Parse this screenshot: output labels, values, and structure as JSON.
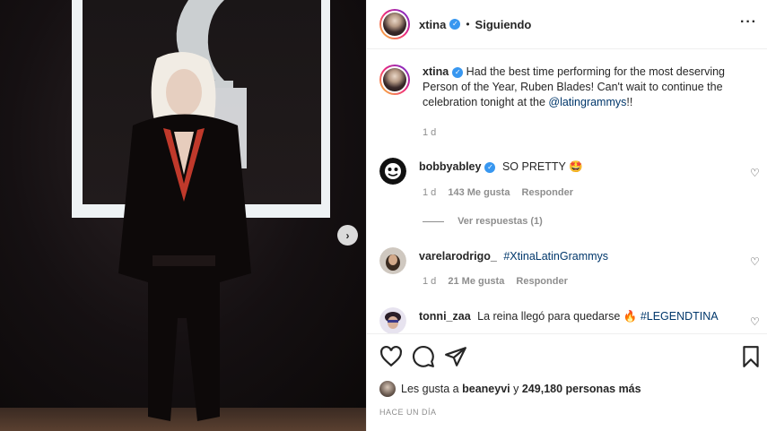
{
  "header": {
    "username": "xtina",
    "separator": "•",
    "follow_status": "Siguiendo",
    "more_icon": "more-horizontal-icon"
  },
  "caption": {
    "username": "xtina",
    "text": "Had the best time performing for the most deserving Person of the Year, Ruben Blades! Can't wait to continue the celebration tonight at the ",
    "mention": "@latingrammys",
    "suffix": "!!",
    "time": "1 d"
  },
  "comments": [
    {
      "username": "bobbyabley",
      "verified": true,
      "text": "SO PRETTY 🤩",
      "time": "1 d",
      "likes": "143 Me gusta",
      "reply": "Responder",
      "view_replies": "Ver respuestas (1)"
    },
    {
      "username": "varelarodrigo_",
      "verified": false,
      "hashtag": "#XtinaLatinGrammys",
      "time": "1 d",
      "likes": "21 Me gusta",
      "reply": "Responder"
    },
    {
      "username": "tonni_zaa",
      "verified": false,
      "text": "La reina llegó para quedarse 🔥",
      "hashtag": "#LEGENDTINA"
    }
  ],
  "likes": {
    "prefix": "Les gusta a",
    "user": "beaneyvi",
    "middle": "y",
    "count": "249,180 personas más"
  },
  "posted_ago": "HACE UN DÍA",
  "colors": {
    "accent": "#3897f0",
    "link": "#00376b",
    "muted": "#8e8e8e"
  }
}
